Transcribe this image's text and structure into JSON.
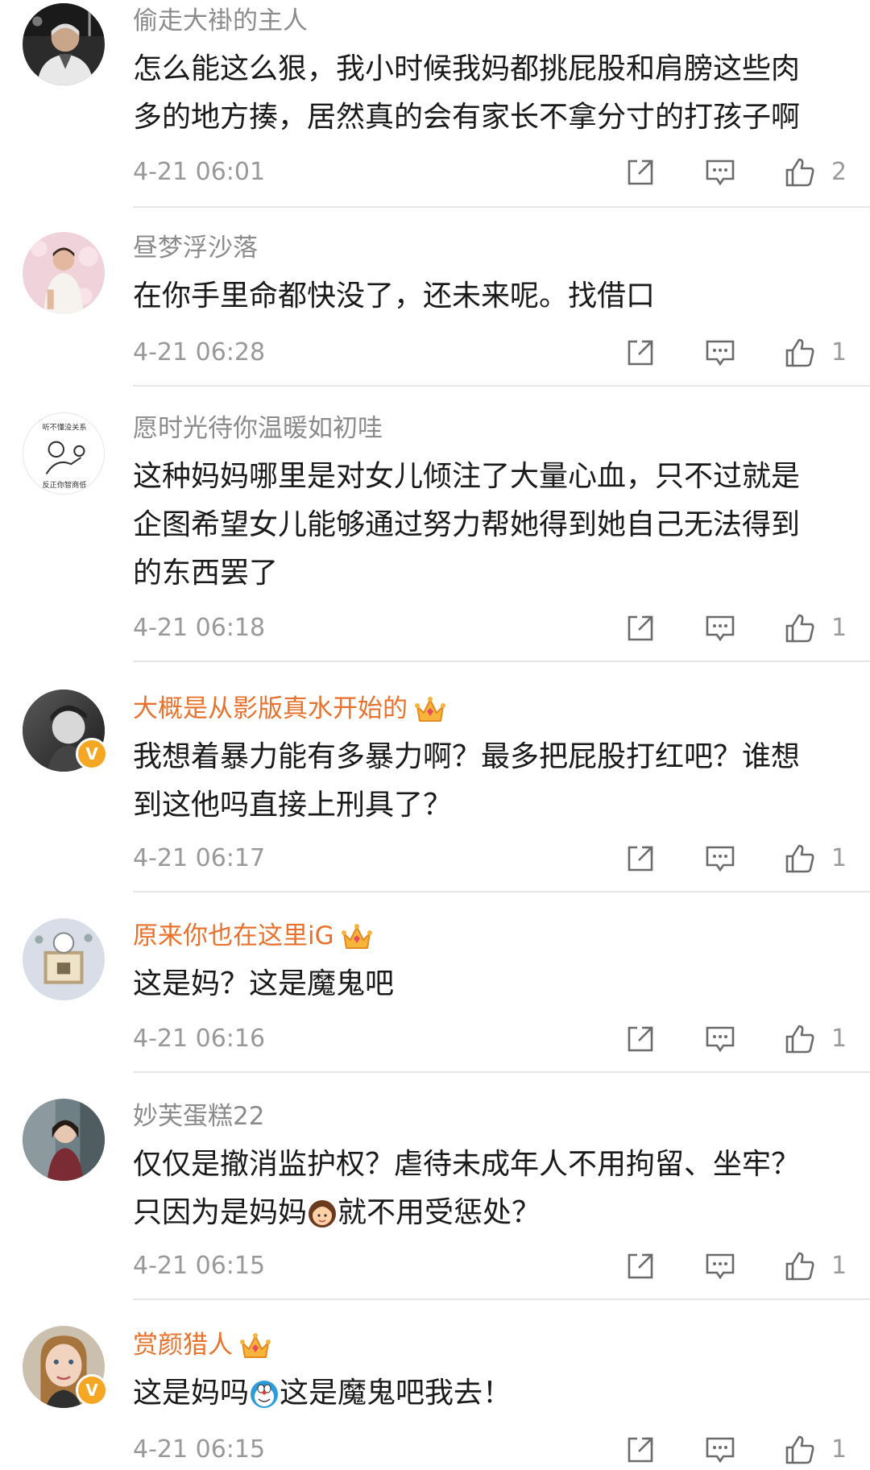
{
  "colors": {
    "vip_username": "#e8722c",
    "username": "#8b8b8b",
    "text": "#1a1a1a",
    "meta": "#999999",
    "divider": "#e6e6e6",
    "verified_badge": "#f5a623"
  },
  "comments": [
    {
      "username": "偷走大褂的主人",
      "vip": false,
      "verified": false,
      "lines": [
        "怎么能这么狠，我小时候我妈都挑屁股和肩膀这些肉",
        "多的地方揍，居然真的会有家长不拿分寸的打孩子啊"
      ],
      "time": "4-21 06:01",
      "likes": "2"
    },
    {
      "username": "昼梦浮沙落",
      "vip": false,
      "verified": false,
      "lines": [
        "在你手里命都快没了，还未来呢。找借口"
      ],
      "time": "4-21 06:28",
      "likes": "1"
    },
    {
      "username": "愿时光待你温暖如初哇",
      "vip": false,
      "verified": false,
      "lines": [
        "这种妈妈哪里是对女儿倾注了大量心血，只不过就是",
        "企图希望女儿能够通过努力帮她得到她自己无法得到",
        "的东西罢了"
      ],
      "time": "4-21 06:18",
      "likes": "1"
    },
    {
      "username": "大概是从影版真水开始的",
      "vip": true,
      "verified": true,
      "lines": [
        "我想着暴力能有多暴力啊？最多把屁股打红吧？谁想",
        "到这他吗直接上刑具了？"
      ],
      "time": "4-21 06:17",
      "likes": "1"
    },
    {
      "username": "原来你也在这里iG",
      "vip": true,
      "verified": false,
      "lines": [
        "这是妈？这是魔鬼吧"
      ],
      "time": "4-21 06:16",
      "likes": "1"
    },
    {
      "username": "妙芙蛋糕22",
      "vip": false,
      "verified": false,
      "lines": [
        "仅仅是撤消监护权？虐待未成年人不用拘留、坐牢？",
        "只因为是妈妈",
        "就不用受惩处？"
      ],
      "time": "4-21 06:15",
      "likes": "1"
    },
    {
      "username": "赏颜猎人",
      "vip": true,
      "verified": true,
      "lines": [
        "这是妈吗",
        "这是魔鬼吧我去！"
      ],
      "time": "4-21 06:15",
      "likes": "1"
    }
  ],
  "avatar_badges": {
    "c3_top": "听不懂没关系",
    "c3_bottom": "反正你智商低"
  },
  "icons": {
    "repost": "share-icon",
    "comment": "comment-icon",
    "like": "thumbs-up-icon",
    "crown": "crown-icon",
    "verified": "verified-v-icon",
    "emoji_girl": "girl-emoji",
    "emoji_doraemon": "doraemon-emoji"
  }
}
